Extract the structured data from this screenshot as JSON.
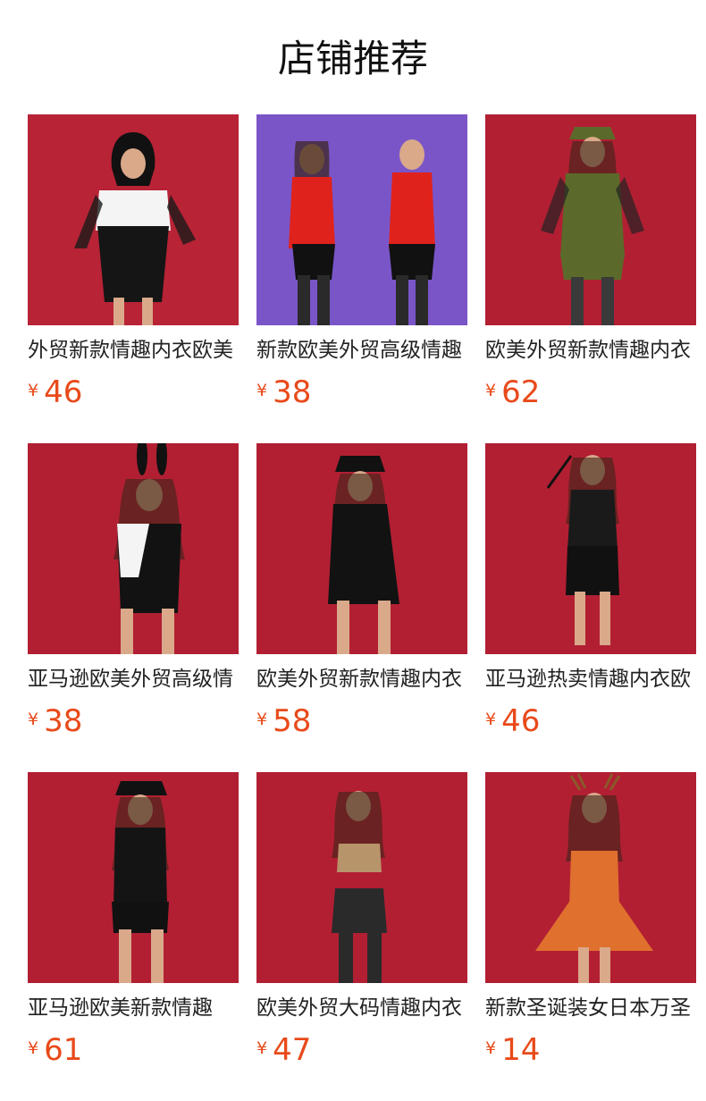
{
  "page": {
    "title": "店铺推荐"
  },
  "colors": {
    "price": "#e84a1a",
    "backdrop_red": "#b21f33",
    "backdrop_purple": "#7a55c8"
  },
  "currency_symbol": "¥",
  "products": [
    {
      "name": "外贸新款情趣内衣欧美",
      "price": "46",
      "backdrop": "red"
    },
    {
      "name": "新款欧美外贸高级情趣",
      "price": "38",
      "backdrop": "purple"
    },
    {
      "name": "欧美外贸新款情趣内衣",
      "price": "62",
      "backdrop": "red"
    },
    {
      "name": "亚马逊欧美外贸高级情",
      "price": "38",
      "backdrop": "red"
    },
    {
      "name": "欧美外贸新款情趣内衣",
      "price": "58",
      "backdrop": "red"
    },
    {
      "name": "亚马逊热卖情趣内衣欧",
      "price": "46",
      "backdrop": "red"
    },
    {
      "name": "亚马逊欧美新款情趣",
      "price": "61",
      "backdrop": "red"
    },
    {
      "name": "欧美外贸大码情趣内衣",
      "price": "47",
      "backdrop": "red"
    },
    {
      "name": "新款圣诞装女日本万圣",
      "price": "14",
      "backdrop": "red"
    }
  ]
}
